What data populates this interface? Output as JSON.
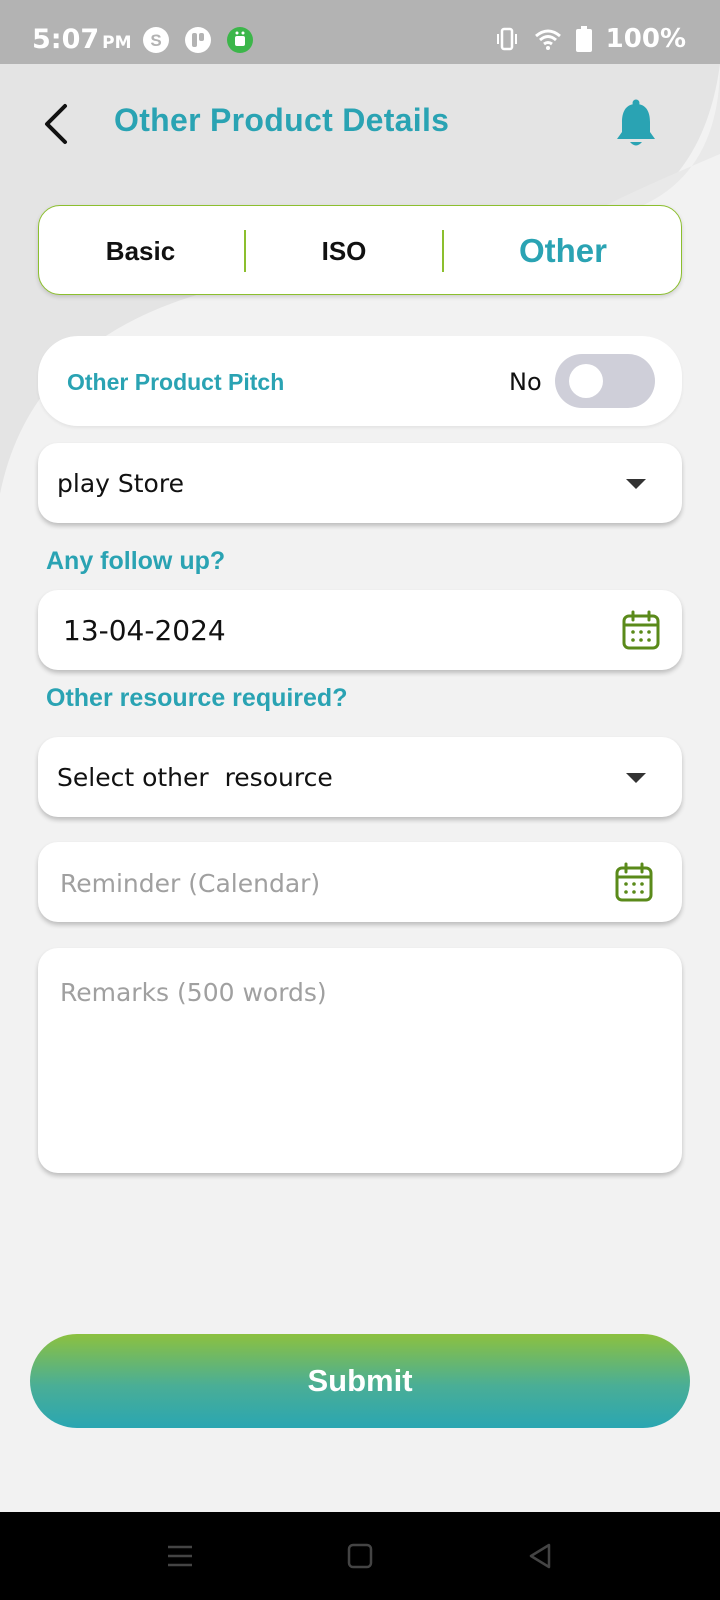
{
  "status_bar": {
    "time": "5:07",
    "ampm": "PM",
    "battery": "100%",
    "icons": [
      "skype-icon",
      "app-icon",
      "android-icon",
      "vibrate-icon",
      "wifi-icon",
      "battery-icon"
    ]
  },
  "header": {
    "title": "Other Product Details",
    "back_icon": "chevron-left-icon",
    "bell_icon": "bell-icon"
  },
  "tabs": [
    {
      "label": "Basic",
      "active": false
    },
    {
      "label": "ISO",
      "active": false
    },
    {
      "label": "Other",
      "active": true
    }
  ],
  "pitch": {
    "label": "Other Product Pitch",
    "value": "No",
    "toggled": false
  },
  "product_select": {
    "value": "play Store"
  },
  "follow_up": {
    "label": "Any follow up?",
    "date": "13-04-2024"
  },
  "resource": {
    "label": "Other resource required?",
    "select_value": "Select other  resource"
  },
  "reminder": {
    "placeholder": "Reminder (Calendar)"
  },
  "remarks": {
    "placeholder": "Remarks (500 words)"
  },
  "submit_label": "Submit",
  "colors": {
    "accent": "#2aa3b3",
    "green": "#8cbf2e",
    "icon_green": "#5a8a1a",
    "background": "#f2f2f2"
  }
}
